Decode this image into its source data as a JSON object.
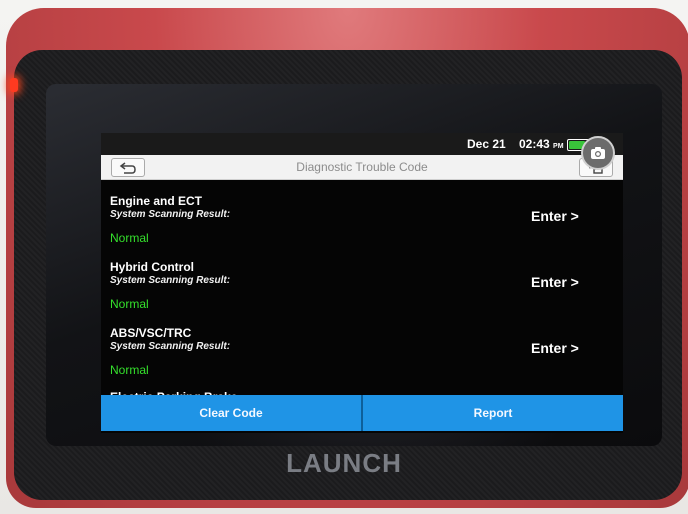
{
  "status_bar": {
    "date": "Dec 21",
    "time": "02:43",
    "meridiem": "PM",
    "battery_level": 0.8
  },
  "header": {
    "title": "Diagnostic Trouble Code"
  },
  "systems": [
    {
      "name": "Engine and ECT",
      "subtitle": "System Scanning Result:",
      "status": "Normal",
      "enter_label": "Enter >"
    },
    {
      "name": "Hybrid Control",
      "subtitle": "System Scanning Result:",
      "status": "Normal",
      "enter_label": "Enter >"
    },
    {
      "name": "ABS/VSC/TRC",
      "subtitle": "System Scanning Result:",
      "status": "Normal",
      "enter_label": "Enter >"
    },
    {
      "name": "Electric Parking Brake"
    }
  ],
  "footer": {
    "clear_code_label": "Clear Code",
    "report_label": "Report"
  },
  "device": {
    "brand": "LAUNCH"
  },
  "colors": {
    "status_normal": "#35e02c",
    "button_blue": "#1f94e6",
    "housing_red": "#c9494c"
  }
}
